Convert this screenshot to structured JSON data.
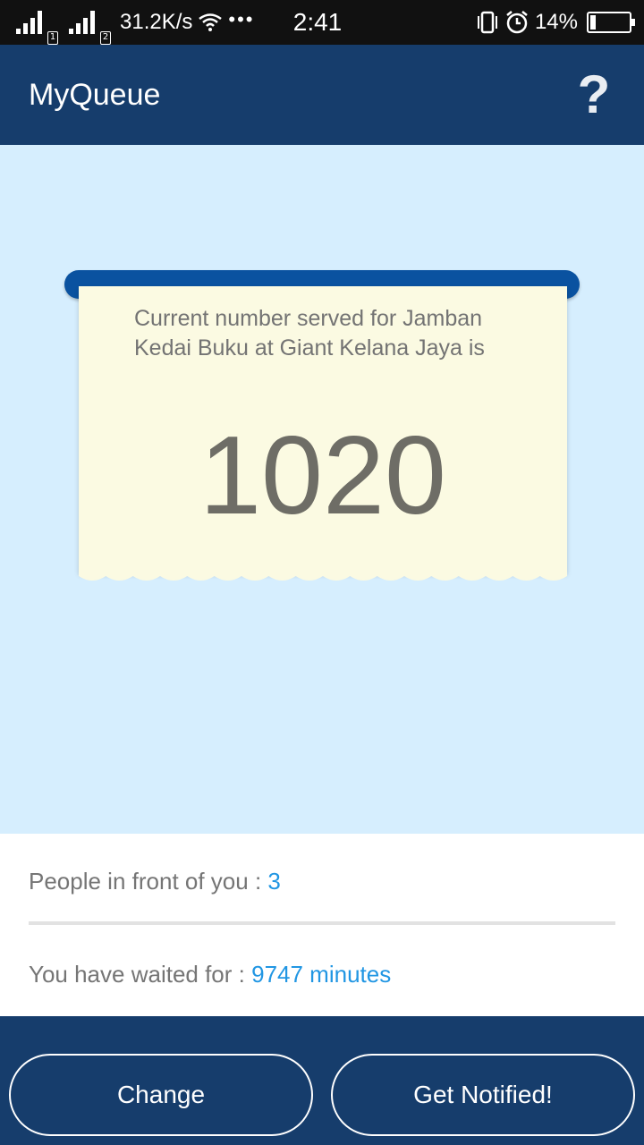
{
  "status_bar": {
    "net_speed": "31.2K/s",
    "sim1": "1",
    "sim2": "2",
    "overflow": "•••",
    "time": "2:41",
    "battery": "14%",
    "battery_level": 0.14
  },
  "app_bar": {
    "title": "MyQueue",
    "help_icon": "?"
  },
  "ticket": {
    "label": "Current number served for Jamban Kedai Buku at Giant Kelana Jaya is",
    "number": "1020"
  },
  "info": {
    "people_label": "People in front of you : ",
    "people_value": "3",
    "wait_label": "You have waited for : ",
    "wait_value": "9747 minutes"
  },
  "actions": {
    "change_label": "Change",
    "notify_label": "Get Notified!"
  },
  "colors": {
    "app_bar": "#163d6c",
    "main_bg": "#d6eefe",
    "ticket_bg": "#fbfae2",
    "ticket_slot": "#0a52a0",
    "value_accent": "#2196e3"
  }
}
